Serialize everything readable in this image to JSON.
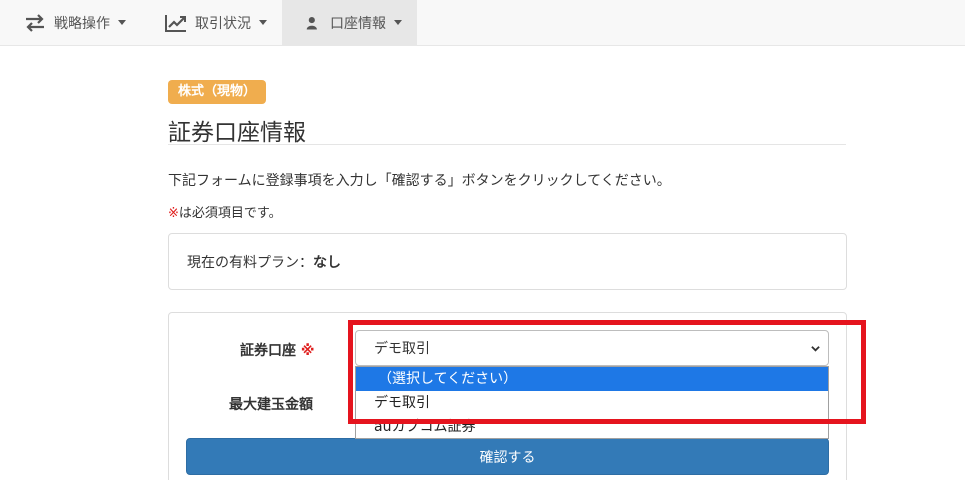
{
  "nav": {
    "items": [
      {
        "label": "戦略操作",
        "icon": "exchange-arrows-icon"
      },
      {
        "label": "取引状況",
        "icon": "line-chart-icon"
      },
      {
        "label": "口座情報",
        "icon": "user-icon"
      }
    ]
  },
  "page": {
    "badge": "株式（現物）",
    "title": "証券口座情報",
    "instructions": "下記フォームに登録事項を入力し「確認する」ボタンをクリックしてください。",
    "required_mark": "※",
    "required_note": "は必須項目です。"
  },
  "plan": {
    "label": "現在の有料プラン：",
    "value": "なし"
  },
  "form": {
    "account_label": "証券口座",
    "required_mark": "※",
    "account_selected": "デモ取引",
    "account_options": [
      "（選択してください）",
      "デモ取引",
      "auカブコム証券"
    ],
    "max_label": "最大建玉金額",
    "confirm_label": "確認する"
  },
  "colors": {
    "badge": "#f0ad4e",
    "primary": "#337ab7",
    "option_highlight": "#1e78e6",
    "annotation_red": "#e5141e"
  }
}
